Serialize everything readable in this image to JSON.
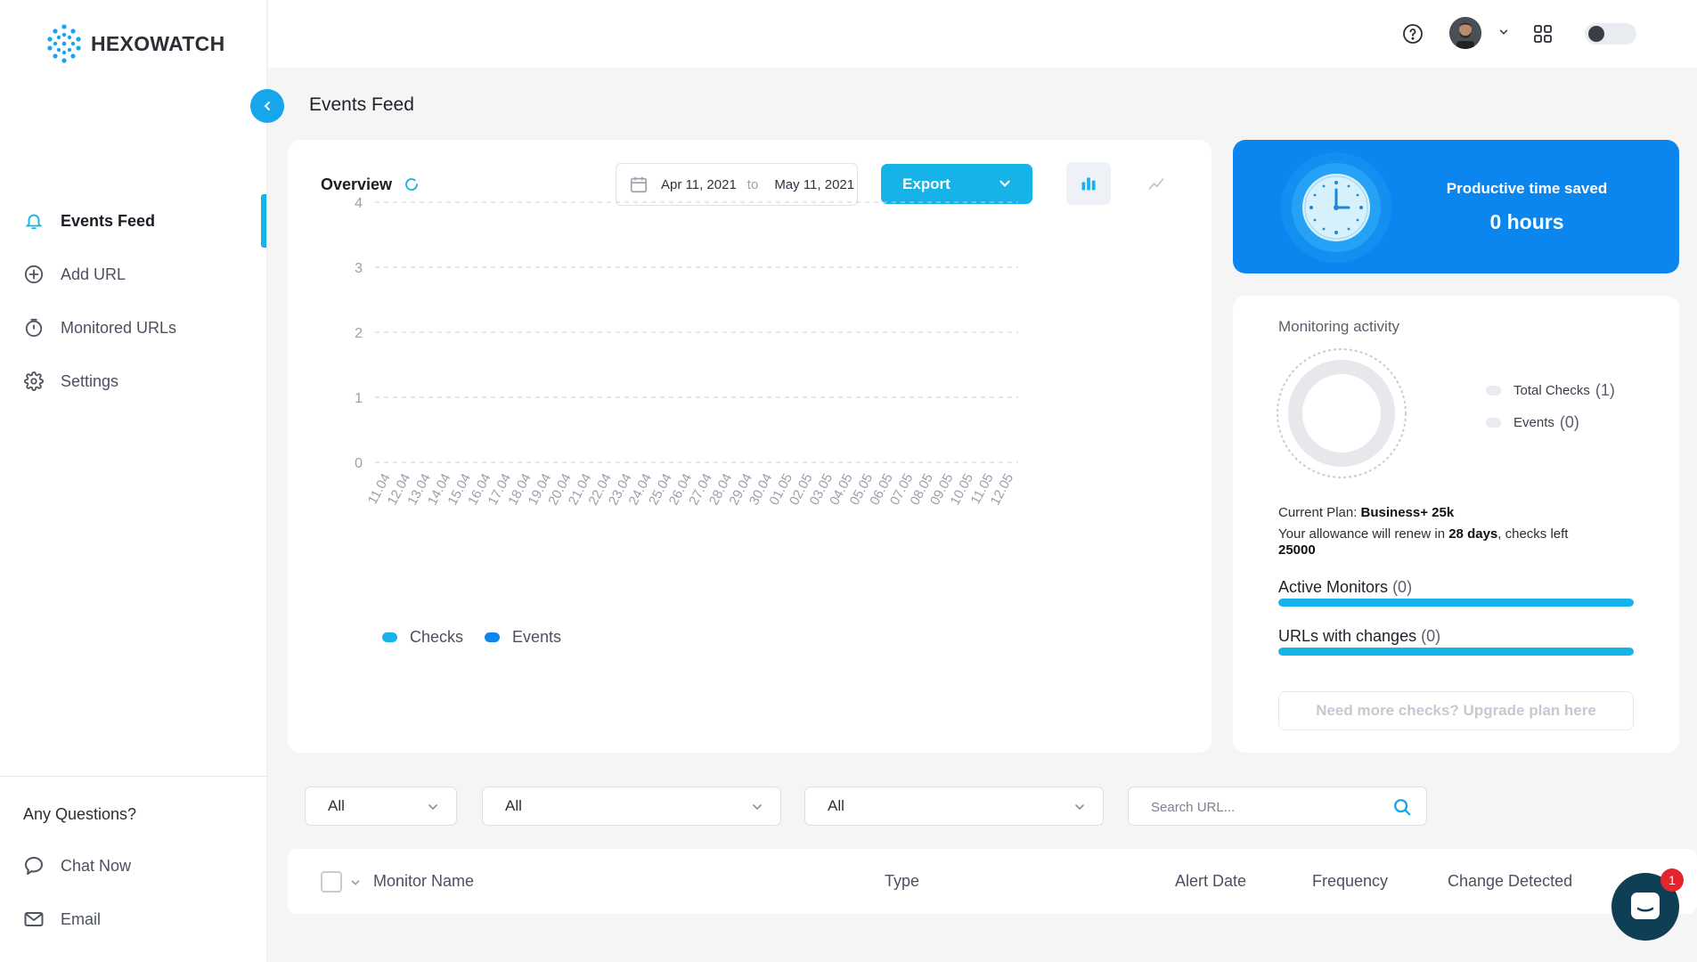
{
  "brand": {
    "name": "HEXOWATCH"
  },
  "sidebar": {
    "items": [
      {
        "label": "Events Feed",
        "icon": "bell-icon",
        "active": true
      },
      {
        "label": "Add URL",
        "icon": "plus-circle-icon"
      },
      {
        "label": "Monitored URLs",
        "icon": "stopwatch-icon"
      },
      {
        "label": "Settings",
        "icon": "gear-icon"
      }
    ],
    "questions_title": "Any Questions?",
    "support": [
      {
        "label": "Chat Now",
        "icon": "chat-icon"
      },
      {
        "label": "Email",
        "icon": "mail-icon"
      }
    ]
  },
  "topbar": {
    "icons": [
      "help-icon",
      "avatar",
      "chevron-down-icon",
      "apps-grid-icon",
      "theme-toggle"
    ]
  },
  "page": {
    "title": "Events Feed"
  },
  "overview": {
    "title": "Overview",
    "date_from": "Apr 11, 2021",
    "date_to_word": "to",
    "date_to": "May 11, 2021",
    "export_label": "Export"
  },
  "chart_data": {
    "type": "bar",
    "categories": [
      "11.04",
      "12.04",
      "13.04",
      "14.04",
      "15.04",
      "16.04",
      "17.04",
      "18.04",
      "19.04",
      "20.04",
      "21.04",
      "22.04",
      "23.04",
      "24.04",
      "25.04",
      "26.04",
      "27.04",
      "28.04",
      "29.04",
      "30.04",
      "01.05",
      "02.05",
      "03.05",
      "04.05",
      "05.05",
      "06.05",
      "07.05",
      "08.05",
      "09.05",
      "10.05",
      "11.05",
      "12.05"
    ],
    "series": [
      {
        "name": "Checks",
        "color": "#15b3e8",
        "values": [
          0,
          0,
          0,
          0,
          0,
          0,
          0,
          0,
          0,
          0,
          0,
          0,
          0,
          0,
          0,
          0,
          0,
          0,
          0,
          0,
          0,
          0,
          0,
          0,
          0,
          0,
          0,
          0,
          0,
          0,
          0,
          0
        ]
      },
      {
        "name": "Events",
        "color": "#0c86ef",
        "values": [
          0,
          0,
          0,
          0,
          0,
          0,
          0,
          0,
          0,
          0,
          0,
          0,
          0,
          0,
          0,
          0,
          0,
          0,
          0,
          0,
          0,
          0,
          0,
          0,
          0,
          0,
          0,
          0,
          0,
          0,
          0,
          0
        ]
      }
    ],
    "yticks": [
      "4",
      "3",
      "2",
      "1",
      "0"
    ],
    "ylim": [
      0,
      4
    ],
    "grid": true,
    "legend_position": "bottom-left"
  },
  "productive": {
    "title": "Productive time saved",
    "value": "0 hours"
  },
  "monitoring": {
    "title": "Monitoring activity",
    "legend": [
      {
        "label": "Total Checks",
        "count": "(1)"
      },
      {
        "label": "Events",
        "count": "(0)"
      }
    ],
    "plan_label": "Current Plan:",
    "plan_name": "Business+ 25k",
    "allow_prefix": "Your allowance will renew in",
    "allow_days": "28 days",
    "allow_mid": ", checks left",
    "allow_checks": "25000",
    "active_monitors_label": "Active Monitors",
    "active_monitors_count": "(0)",
    "active_monitors_progress": 1.0,
    "urls_changes_label": "URLs with changes",
    "urls_changes_count": "(0)",
    "urls_changes_progress": 1.0,
    "upgrade_label": "Need more checks? Upgrade plan here"
  },
  "filters": {
    "f1": "All",
    "f2": "All",
    "f3": "All",
    "search_placeholder": "Search URL..."
  },
  "table": {
    "columns": [
      "Monitor Name",
      "Type",
      "Alert Date",
      "Frequency",
      "Change Detected"
    ]
  },
  "chat": {
    "badge": "1"
  }
}
